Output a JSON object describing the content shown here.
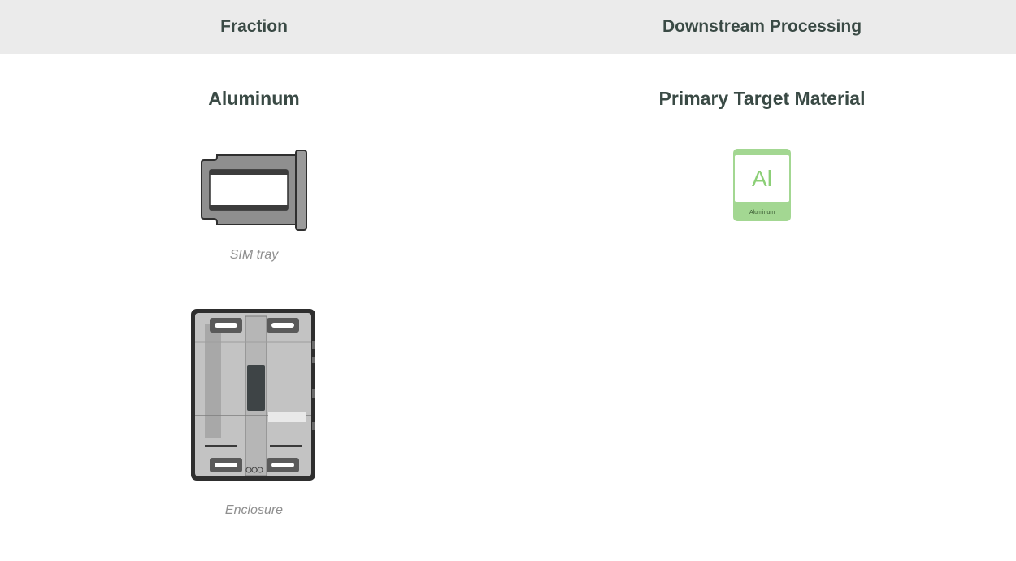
{
  "header": {
    "fraction_label": "Fraction",
    "processing_label": "Downstream Processing"
  },
  "fraction": {
    "title": "Aluminum",
    "items": [
      {
        "caption": "SIM tray",
        "icon": "sim-tray-image"
      },
      {
        "caption": "Enclosure",
        "icon": "enclosure-image"
      }
    ]
  },
  "processing": {
    "title": "Primary Target Material",
    "material": {
      "symbol": "Al",
      "name": "Aluminum",
      "color": "#a3d792"
    }
  }
}
